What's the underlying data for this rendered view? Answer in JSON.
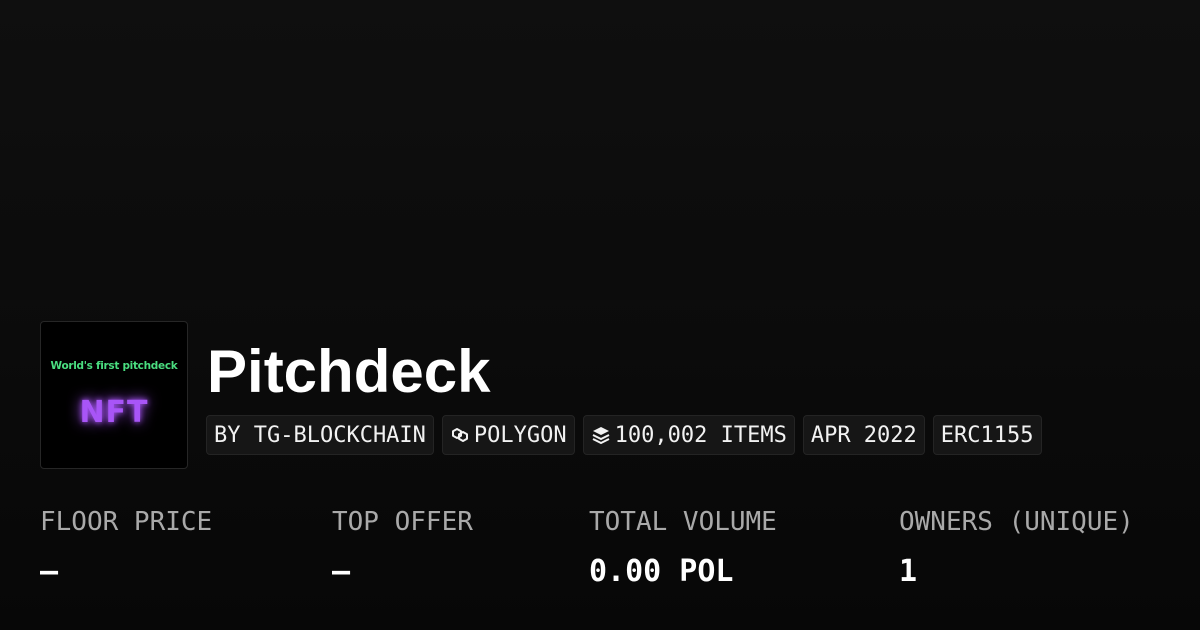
{
  "collection": {
    "title": "Pitchdeck",
    "avatar": {
      "tagline": "World's first pitchdeck",
      "label": "NFT",
      "tagline_color": "#4ade80",
      "label_color": "#a855f7"
    }
  },
  "tags": {
    "creator": "BY TG-BLOCKCHAIN",
    "chain": "POLYGON",
    "chain_icon": "polygon-icon",
    "items": "100,002 ITEMS",
    "items_icon": "layers-icon",
    "date": "APR 2022",
    "standard": "ERC1155"
  },
  "stats": {
    "floor_price": {
      "label": "FLOOR PRICE",
      "value": "–"
    },
    "top_offer": {
      "label": "TOP OFFER",
      "value": "–"
    },
    "total_volume": {
      "label": "TOTAL VOLUME",
      "value": "0.00 POL"
    },
    "owners": {
      "label": "OWNERS (UNIQUE)",
      "value": "1"
    }
  },
  "colors": {
    "background": "#0b0b0b",
    "tag_background": "#161616",
    "label_gray": "#a9a9a9"
  }
}
